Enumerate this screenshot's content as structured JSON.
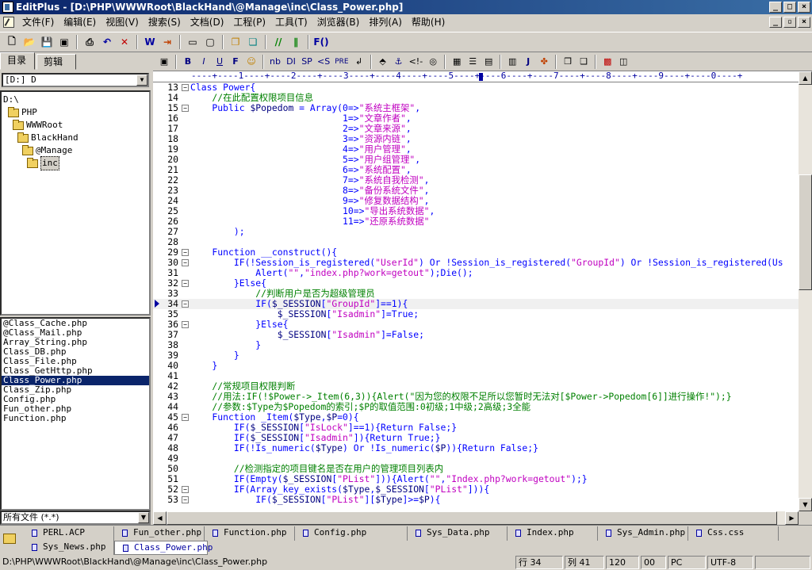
{
  "window": {
    "title": "EditPlus - [D:\\PHP\\WWWRoot\\BlackHand\\@Manage\\inc\\Class_Power.php]"
  },
  "menu": [
    "文件(F)",
    "编辑(E)",
    "视图(V)",
    "搜索(S)",
    "文档(D)",
    "工程(P)",
    "工具(T)",
    "浏览器(B)",
    "排列(A)",
    "帮助(H)"
  ],
  "sidebar": {
    "tab_directory": "目录",
    "tab_clipboard": "剪辑",
    "drive": "[D:] D",
    "tree": [
      "D:\\",
      "PHP",
      "WWWRoot",
      "BlackHand",
      "@Manage",
      "inc"
    ],
    "files": [
      "@Class_Cache.php",
      "@Class_Mail.php",
      "Array_String.php",
      "Class_DB.php",
      "Class_File.php",
      "Class_GetHttp.php",
      "Class_Power.php",
      "Class_Zip.php",
      "Config.php",
      "Fun_other.php",
      "Function.php"
    ],
    "filter": "所有文件 (*.*)"
  },
  "editor": {
    "ruler": "----+----1----+----2----+----3----+----4----+----5----+----6----+----7----+----8----+----9----+----0----+",
    "toolbar2": [
      "B",
      "I",
      "U",
      "F",
      "nb",
      "DI",
      "SP",
      "<S",
      "PRE",
      "J"
    ],
    "lines": [
      {
        "n": "13",
        "t": "Class Power{"
      },
      {
        "n": "14",
        "t": "    //在此配置权限项目信息"
      },
      {
        "n": "15",
        "t": "    Public $Popedom = Array(0=>\"系统主框架\","
      },
      {
        "n": "16",
        "t": "                            1=>\"文章作者\","
      },
      {
        "n": "17",
        "t": "                            2=>\"文章来源\","
      },
      {
        "n": "18",
        "t": "                            3=>\"资源内链\","
      },
      {
        "n": "19",
        "t": "                            4=>\"用户管理\","
      },
      {
        "n": "20",
        "t": "                            5=>\"用户组管理\","
      },
      {
        "n": "21",
        "t": "                            6=>\"系统配置\","
      },
      {
        "n": "22",
        "t": "                            7=>\"系统自我检测\","
      },
      {
        "n": "23",
        "t": "                            8=>\"备份系统文件\","
      },
      {
        "n": "24",
        "t": "                            9=>\"修复数据结构\","
      },
      {
        "n": "25",
        "t": "                            10=>\"导出系统数据\","
      },
      {
        "n": "26",
        "t": "                            11=>\"还原系统数据\""
      },
      {
        "n": "27",
        "t": "        );"
      },
      {
        "n": "28",
        "t": ""
      },
      {
        "n": "29",
        "t": "    Function __construct(){"
      },
      {
        "n": "30",
        "t": "        IF(!Session_is_registered(\"UserId\") Or !Session_is_registered(\"GroupId\") Or !Session_is_registered(\"Us"
      },
      {
        "n": "31",
        "t": "            Alert(\"\",\"index.php?work=getout\");Die();"
      },
      {
        "n": "32",
        "t": "        }Else{"
      },
      {
        "n": "33",
        "t": "            //判断用户是否为超级管理员"
      },
      {
        "n": "34",
        "t": "            IF($_SESSION[\"GroupId\"]==1){"
      },
      {
        "n": "35",
        "t": "                $_SESSION[\"Isadmin\"]=True;"
      },
      {
        "n": "36",
        "t": "            }Else{"
      },
      {
        "n": "37",
        "t": "                $_SESSION[\"Isadmin\"]=False;"
      },
      {
        "n": "38",
        "t": "            }"
      },
      {
        "n": "39",
        "t": "        }"
      },
      {
        "n": "40",
        "t": "    }"
      },
      {
        "n": "41",
        "t": ""
      },
      {
        "n": "42",
        "t": "    //常规项目权限判断"
      },
      {
        "n": "43",
        "t": "    //用法:IF(!$Power->_Item(6,3)){Alert(\"因为您的权限不足所以您暂时无法对[$Power->Popedom[6]]进行操作!\");}"
      },
      {
        "n": "44",
        "t": "    //参数:$Type为$Popedom的索引;$P的取值范围:0初级;1中级;2高级;3全能"
      },
      {
        "n": "45",
        "t": "    Function _Item($Type,$P=0){"
      },
      {
        "n": "46",
        "t": "        IF($_SESSION[\"IsLock\"]==1){Return False;}"
      },
      {
        "n": "47",
        "t": "        IF($_SESSION[\"Isadmin\"]){Return True;}"
      },
      {
        "n": "48",
        "t": "        IF(!Is_numeric($Type) Or !Is_numeric($P)){Return False;}"
      },
      {
        "n": "49",
        "t": ""
      },
      {
        "n": "50",
        "t": "        //检测指定的项目键名是否在用户的管理项目列表内"
      },
      {
        "n": "51",
        "t": "        IF(Empty($_SESSION[\"PList\"])){Alert(\"\",\"Index.php?work=getout\");}"
      },
      {
        "n": "52",
        "t": "        IF(Array_key_exists($Type,$_SESSION[\"PList\"])){"
      },
      {
        "n": "53",
        "t": "            IF($_SESSION[\"PList\"][$Type]>=$P){"
      }
    ]
  },
  "doc_tabs": {
    "row1": [
      "PERL.ACP",
      "Fun_other.php",
      "Function.php",
      "Config.php",
      "Sys_Data.php",
      "Index.php",
      "Sys_Admin.php",
      "Css.css"
    ],
    "row2": [
      "Sys_News.php",
      "Class_Power.php"
    ]
  },
  "status": {
    "path": "D:\\PHP\\WWWRoot\\BlackHand\\@Manage\\inc\\Class_Power.php",
    "line": "行 34",
    "col": "列 41",
    "width": "120",
    "num": "00",
    "eol": "PC",
    "encoding": "UTF-8"
  }
}
